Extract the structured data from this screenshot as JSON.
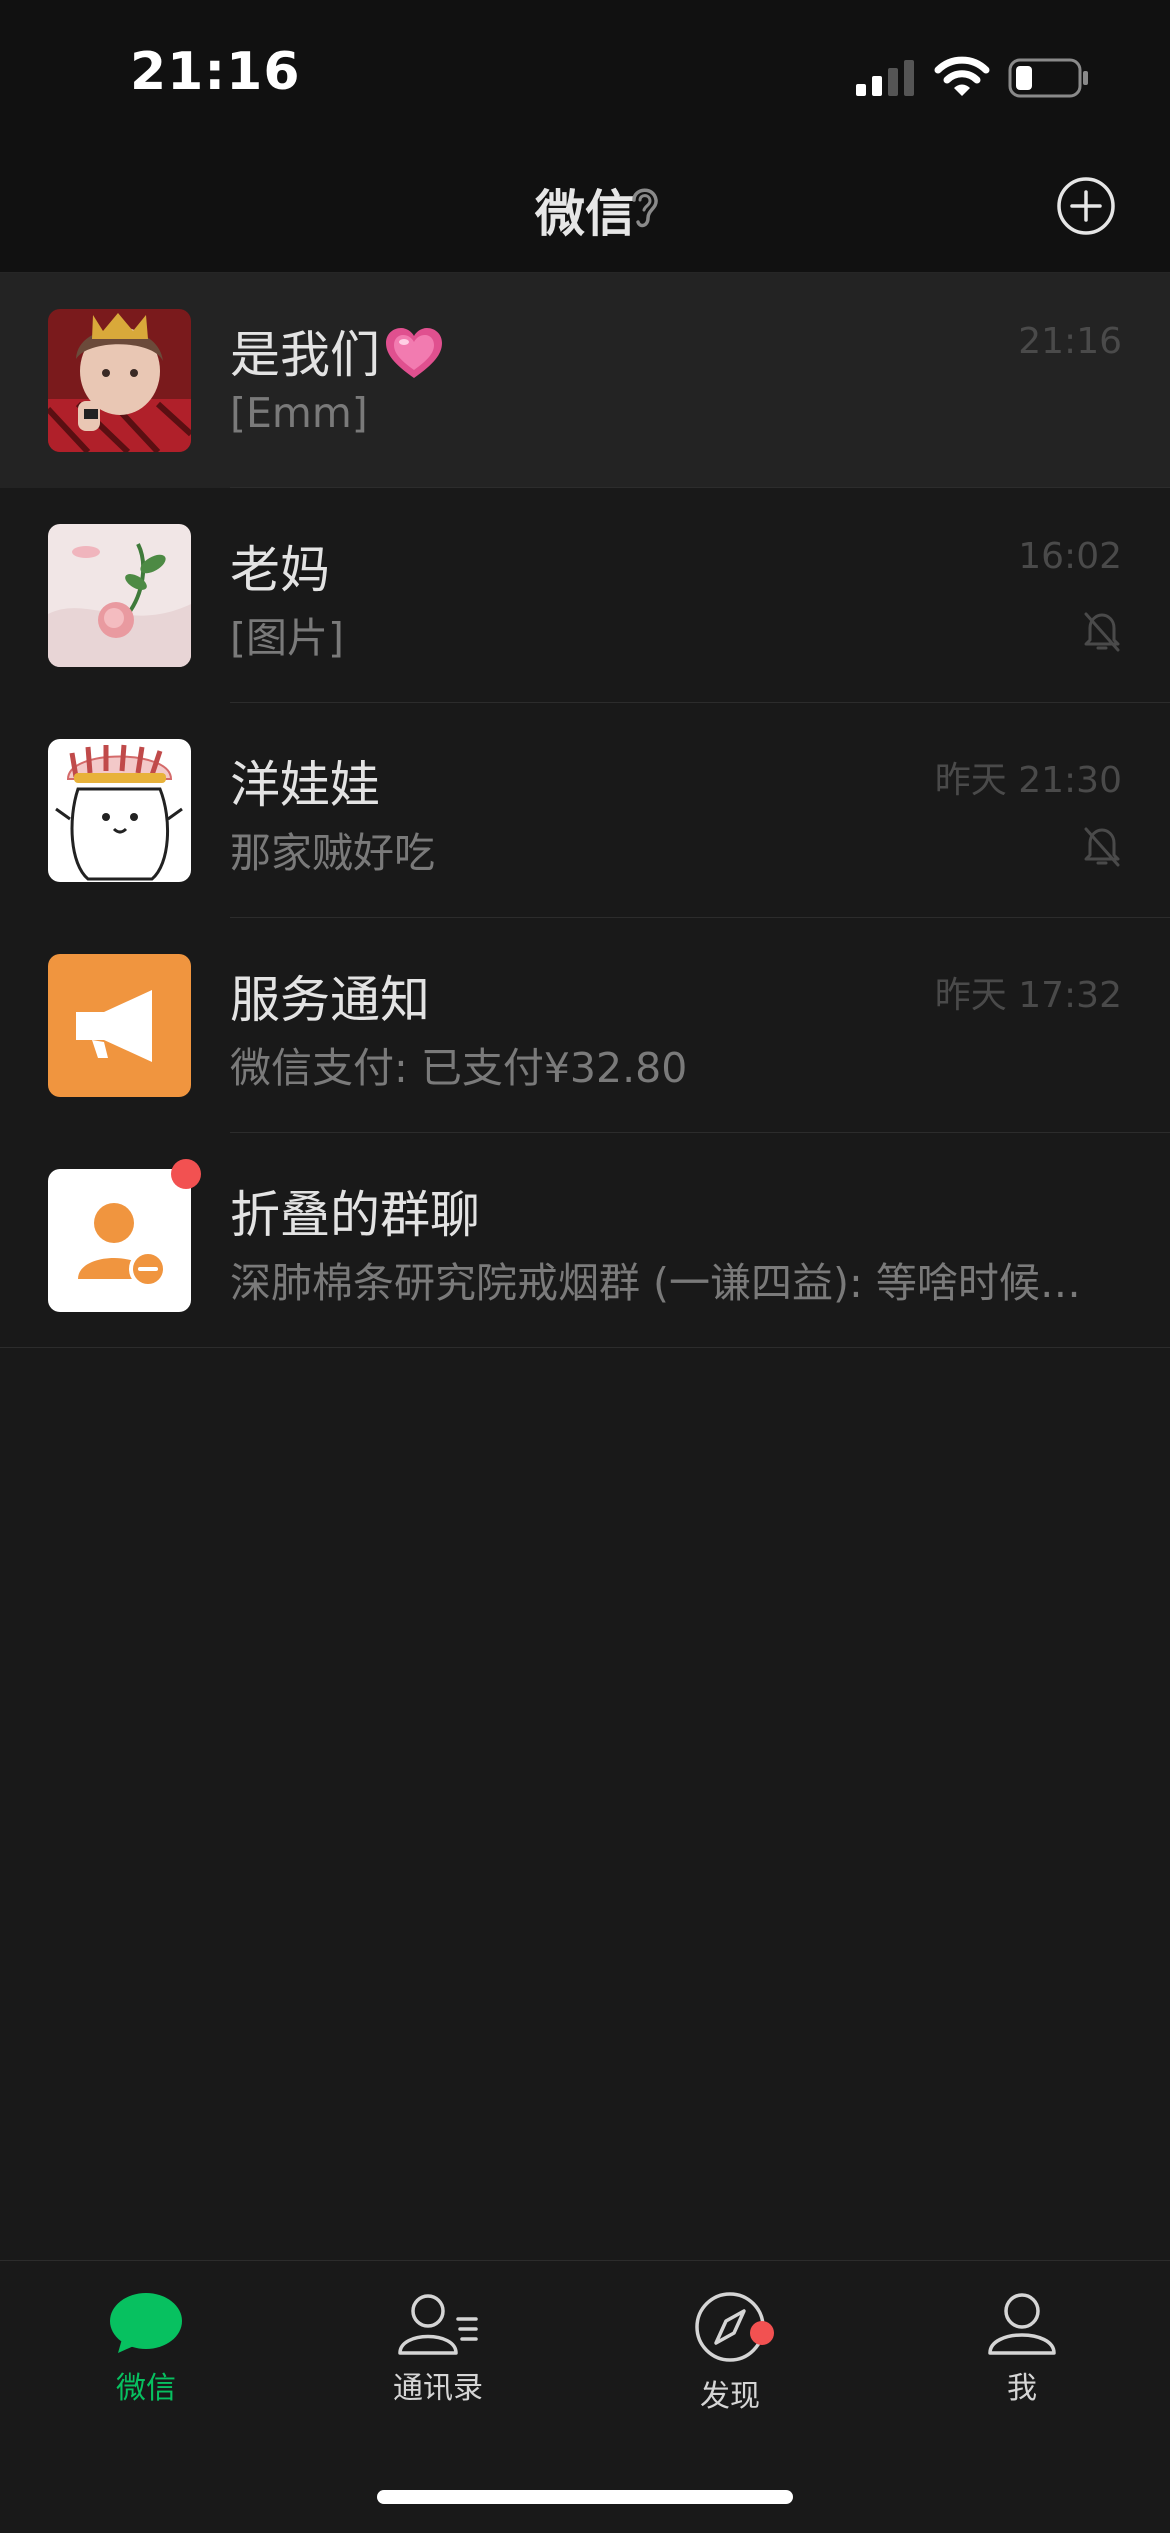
{
  "status_bar": {
    "time": "21:16"
  },
  "header": {
    "title": "微信"
  },
  "chats": [
    {
      "name": "是我们",
      "preview": "[Emm]",
      "time": "21:16",
      "pinned": true,
      "muted": false
    },
    {
      "name": "老妈",
      "preview": "[图片]",
      "time": "16:02",
      "muted": true
    },
    {
      "name": "洋娃娃",
      "preview": "那家贼好吃",
      "time": "昨天 21:30",
      "muted": true
    },
    {
      "name": "服务通知",
      "preview": "微信支付: 已支付¥32.80",
      "time": "昨天 17:32",
      "muted": false
    },
    {
      "name": "折叠的群聊",
      "preview": "深肺棉条研究院戒烟群 (一谦四益): 等啥时候…",
      "time": "",
      "muted": false,
      "badge": "dot"
    }
  ],
  "tabs": [
    {
      "label": "微信",
      "icon": "chat-bubble-icon",
      "active": true
    },
    {
      "label": "通讯录",
      "icon": "contacts-icon"
    },
    {
      "label": "发现",
      "icon": "compass-icon",
      "badge": "dot"
    },
    {
      "label": "我",
      "icon": "person-icon"
    }
  ],
  "colors": {
    "accent": "#07c160",
    "badge": "#f25151",
    "service_orange": "#f0953f",
    "background": "#191919",
    "header": "#111111"
  }
}
